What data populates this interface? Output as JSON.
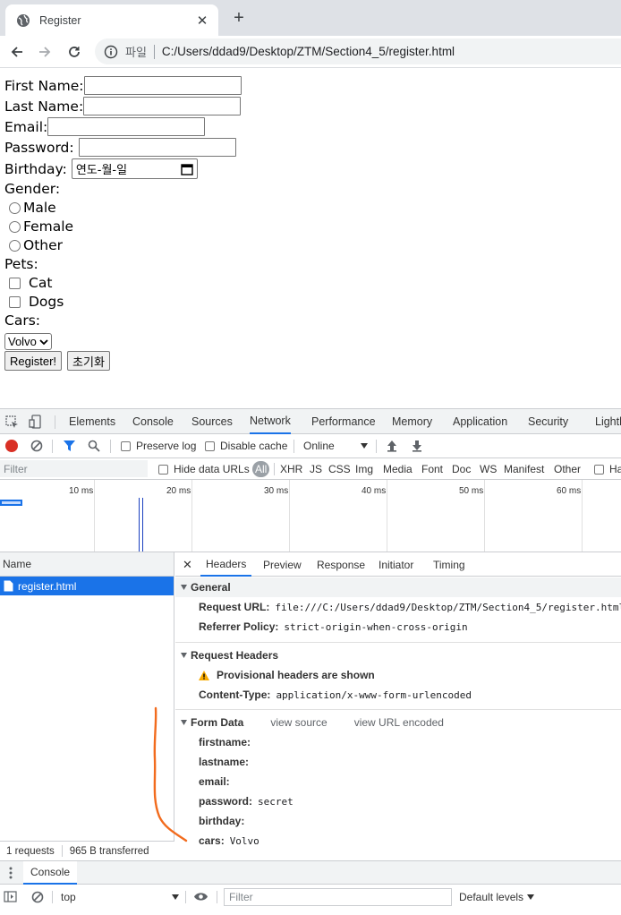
{
  "browser": {
    "tab_title": "Register",
    "new_tab_symbol": "+",
    "close_symbol": "✕",
    "url_scheme_label": "파일",
    "url": "C:/Users/ddad9/Desktop/ZTM/Section4_5/register.html"
  },
  "form": {
    "first_name_label": "First Name:",
    "last_name_label": "Last Name:",
    "email_label": "Email:",
    "password_label": "Password:",
    "birthday_label": "Birthday:",
    "birthday_placeholder": "연도-월-일",
    "gender_label": "Gender:",
    "gender_options": [
      "Male",
      "Female",
      "Other"
    ],
    "pets_label": "Pets:",
    "pets_options": [
      "Cat",
      "Dogs"
    ],
    "cars_label": "Cars:",
    "cars_selected": "Volvo",
    "submit_label": "Register!",
    "reset_label": "초기화"
  },
  "devtools": {
    "panels": [
      "Elements",
      "Console",
      "Sources",
      "Network",
      "Performance",
      "Memory",
      "Application",
      "Security",
      "Lighth"
    ],
    "active_panel": "Network",
    "toolbar": {
      "preserve_log": "Preserve log",
      "disable_cache": "Disable cache",
      "throttle": "Online"
    },
    "filterbar": {
      "filter_placeholder": "Filter",
      "hide_data_urls": "Hide data URLs",
      "types": [
        "All",
        "XHR",
        "JS",
        "CSS",
        "Img",
        "Media",
        "Font",
        "Doc",
        "WS",
        "Manifest",
        "Other"
      ],
      "has_blocked_cookies": "Ha"
    },
    "timeline_ticks": [
      "10 ms",
      "20 ms",
      "30 ms",
      "40 ms",
      "50 ms",
      "60 ms"
    ],
    "request_list": {
      "header": "Name",
      "items": [
        "register.html"
      ],
      "footer_requests": "1 requests",
      "footer_transferred": "965 B transferred"
    },
    "detail": {
      "tabs": [
        "Headers",
        "Preview",
        "Response",
        "Initiator",
        "Timing"
      ],
      "active_tab": "Headers",
      "general": {
        "title": "General",
        "request_url_key": "Request URL:",
        "request_url_value": "file:///C:/Users/ddad9/Desktop/ZTM/Section4_5/register.html",
        "referrer_key": "Referrer Policy:",
        "referrer_value": "strict-origin-when-cross-origin"
      },
      "request_headers": {
        "title": "Request Headers",
        "warning": "Provisional headers are shown",
        "content_type_key": "Content-Type:",
        "content_type_value": "application/x-www-form-urlencoded"
      },
      "form_data": {
        "title": "Form Data",
        "view_source": "view source",
        "view_url_encoded": "view URL encoded",
        "fields": [
          {
            "key": "firstname:",
            "value": ""
          },
          {
            "key": "lastname:",
            "value": ""
          },
          {
            "key": "email:",
            "value": ""
          },
          {
            "key": "password:",
            "value": "secret"
          },
          {
            "key": "birthday:",
            "value": ""
          },
          {
            "key": "cars:",
            "value": "Volvo"
          }
        ]
      }
    },
    "drawer": {
      "tab": "Console",
      "context": "top",
      "filter_placeholder": "Filter",
      "levels": "Default levels"
    }
  },
  "colors": {
    "accent": "#1a73e8",
    "annotation": "#f26b1d"
  }
}
